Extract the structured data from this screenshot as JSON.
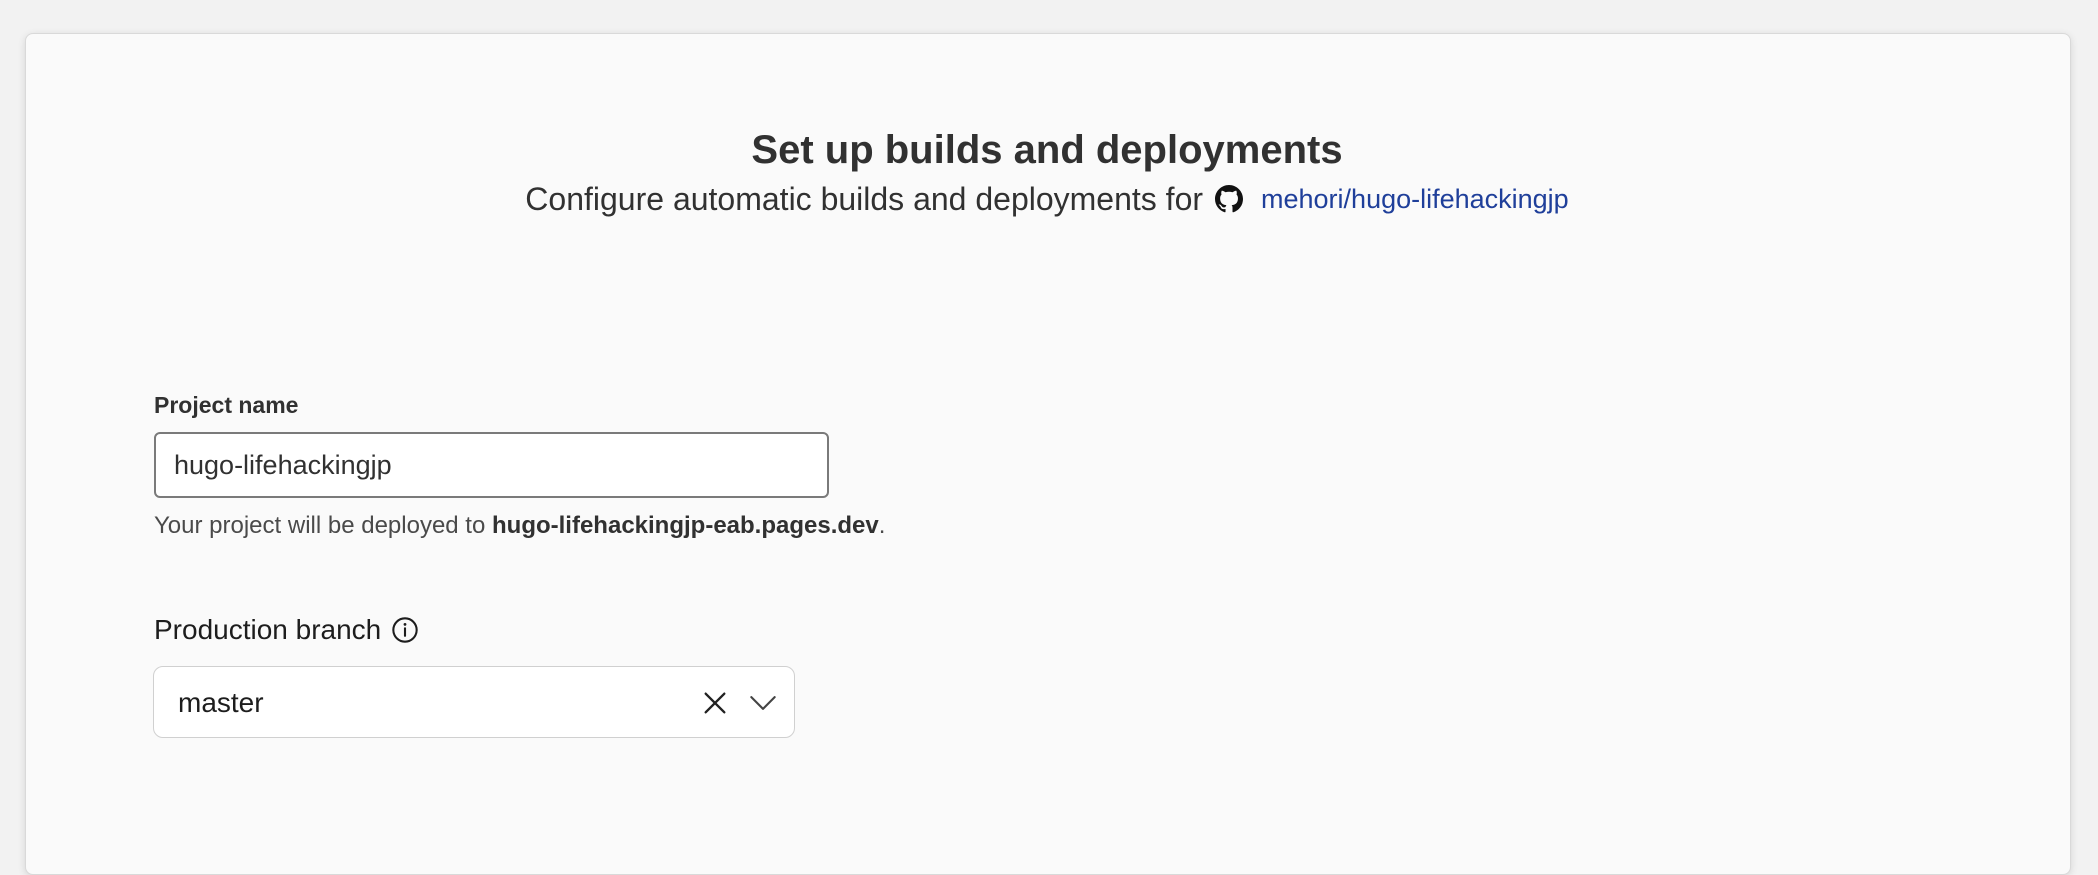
{
  "header": {
    "title": "Set up builds and deployments",
    "subtitle_prefix": "Configure automatic builds and deployments for",
    "repo_icon": "github-icon",
    "repo_link": "mehori/hugo-lifehackingjp"
  },
  "project": {
    "label": "Project name",
    "value": "hugo-lifehackingjp",
    "hint_prefix": "Your project will be deployed to ",
    "hint_domain": "hugo-lifehackingjp-eab.pages.dev",
    "hint_suffix": "."
  },
  "branch": {
    "label": "Production branch",
    "info_icon": "info-icon",
    "selected": "master",
    "clear_icon": "close-icon",
    "dropdown_icon": "chevron-down-icon"
  },
  "colors": {
    "link": "#1f3f9a",
    "text": "#313131",
    "card_background": "#fafafa"
  }
}
